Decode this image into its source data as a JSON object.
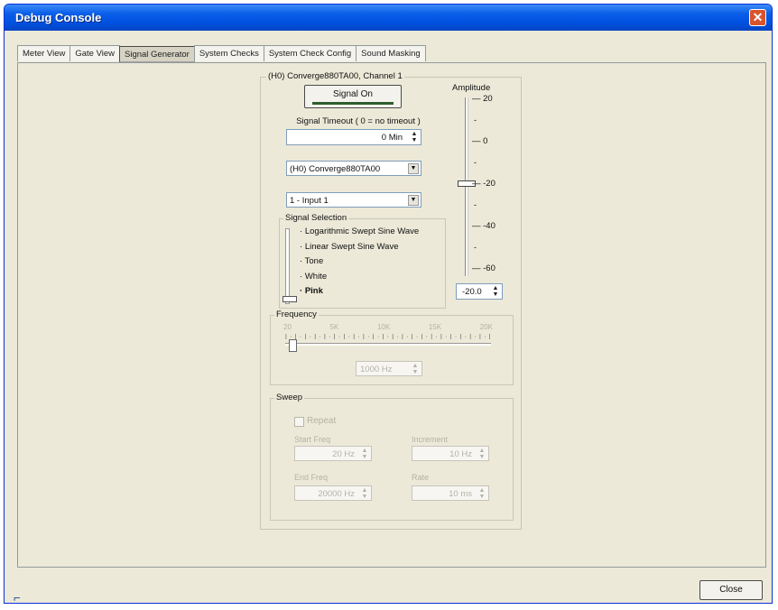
{
  "window": {
    "title": "Debug Console",
    "close_glyph": "✕"
  },
  "tabs": [
    {
      "label": "Meter View"
    },
    {
      "label": "Gate View"
    },
    {
      "label": "Signal Generator"
    },
    {
      "label": "System Checks"
    },
    {
      "label": "System Check Config"
    },
    {
      "label": "Sound Masking"
    }
  ],
  "generator": {
    "group_title": "(H0) Converge880TA00, Channel 1",
    "signal_button": "Signal On",
    "timeout_label": "Signal Timeout ( 0 = no timeout )",
    "timeout_value": "0 Min",
    "device_select": "(H0) Converge880TA00",
    "input_select": "1 - Input 1",
    "signal_selection": {
      "title": "Signal Selection",
      "options": [
        {
          "label": "Logarithmic Swept Sine Wave"
        },
        {
          "label": "Linear Swept Sine Wave"
        },
        {
          "label": "Tone"
        },
        {
          "label": "White"
        },
        {
          "label": "Pink"
        }
      ],
      "selected": "Pink"
    },
    "amplitude": {
      "label": "Amplitude",
      "ticks": [
        "20",
        "0",
        "-20",
        "-40",
        "-60"
      ],
      "value": "-20.0",
      "level": -20
    },
    "frequency": {
      "title": "Frequency",
      "ticks": [
        "20",
        "5K",
        "10K",
        "15K",
        "20K"
      ],
      "value": "1000 Hz"
    },
    "sweep": {
      "title": "Sweep",
      "repeat_label": "Repeat",
      "start_label": "Start Freq",
      "start_value": "20 Hz",
      "end_label": "End Freq",
      "end_value": "20000 Hz",
      "increment_label": "Increment",
      "increment_value": "10 Hz",
      "rate_label": "Rate",
      "rate_value": "10 ms"
    }
  },
  "footer": {
    "close_label": "Close",
    "resize_glyph": "⌐"
  },
  "colors": {
    "title_bar": "#0A5EE8",
    "window_bg": "#ECE9D8",
    "signal_indicator": "#2E5E2E"
  }
}
